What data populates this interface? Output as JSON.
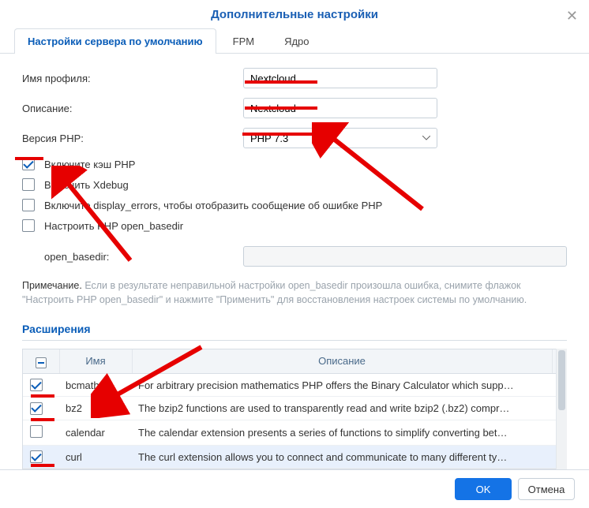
{
  "dialog": {
    "title": "Дополнительные настройки",
    "close": "✕"
  },
  "tabs": {
    "server": "Настройки сервера по умолчанию",
    "fpm": "FPM",
    "core": "Ядро"
  },
  "form": {
    "profile_name_label": "Имя профиля:",
    "profile_name_value": "Nextcloud",
    "description_label": "Описание:",
    "description_value": "Nextcloud",
    "php_version_label": "Версия PHP:",
    "php_version_value": "PHP 7.3"
  },
  "checkboxes": {
    "enable_php_cache": {
      "label": "Включите кэш PHP",
      "checked": true
    },
    "enable_xdebug": {
      "label": "Включить Xdebug",
      "checked": false
    },
    "enable_display_errors": {
      "label": "Включите display_errors, чтобы отобразить сообщение об ошибке PHP",
      "checked": false
    },
    "configure_open_basedir": {
      "label": "Настроить PHP open_basedir",
      "checked": false
    }
  },
  "open_basedir_label": "open_basedir:",
  "note": {
    "label": "Примечание.",
    "text": "Если в результате неправильной настройки open_basedir произошла ошибка, снимите флажок \"Настроить PHP open_basedir\" и нажмите \"Применить\" для восстановления настроек системы по умолчанию."
  },
  "extensions": {
    "title": "Расширения",
    "columns": {
      "name": "Имя",
      "description": "Описание"
    },
    "rows": [
      {
        "checked": true,
        "name": "bcmath",
        "desc": "For arbitrary precision mathematics PHP offers the Binary Calculator which supp…"
      },
      {
        "checked": true,
        "name": "bz2",
        "desc": "The bzip2 functions are used to transparently read and write bzip2 (.bz2) compr…"
      },
      {
        "checked": false,
        "name": "calendar",
        "desc": "The calendar extension presents a series of functions to simplify converting bet…"
      },
      {
        "checked": true,
        "name": "curl",
        "desc": "The curl extension allows you to connect and communicate to many different ty…"
      }
    ]
  },
  "footer": {
    "ok": "OK",
    "cancel": "Отмена"
  }
}
